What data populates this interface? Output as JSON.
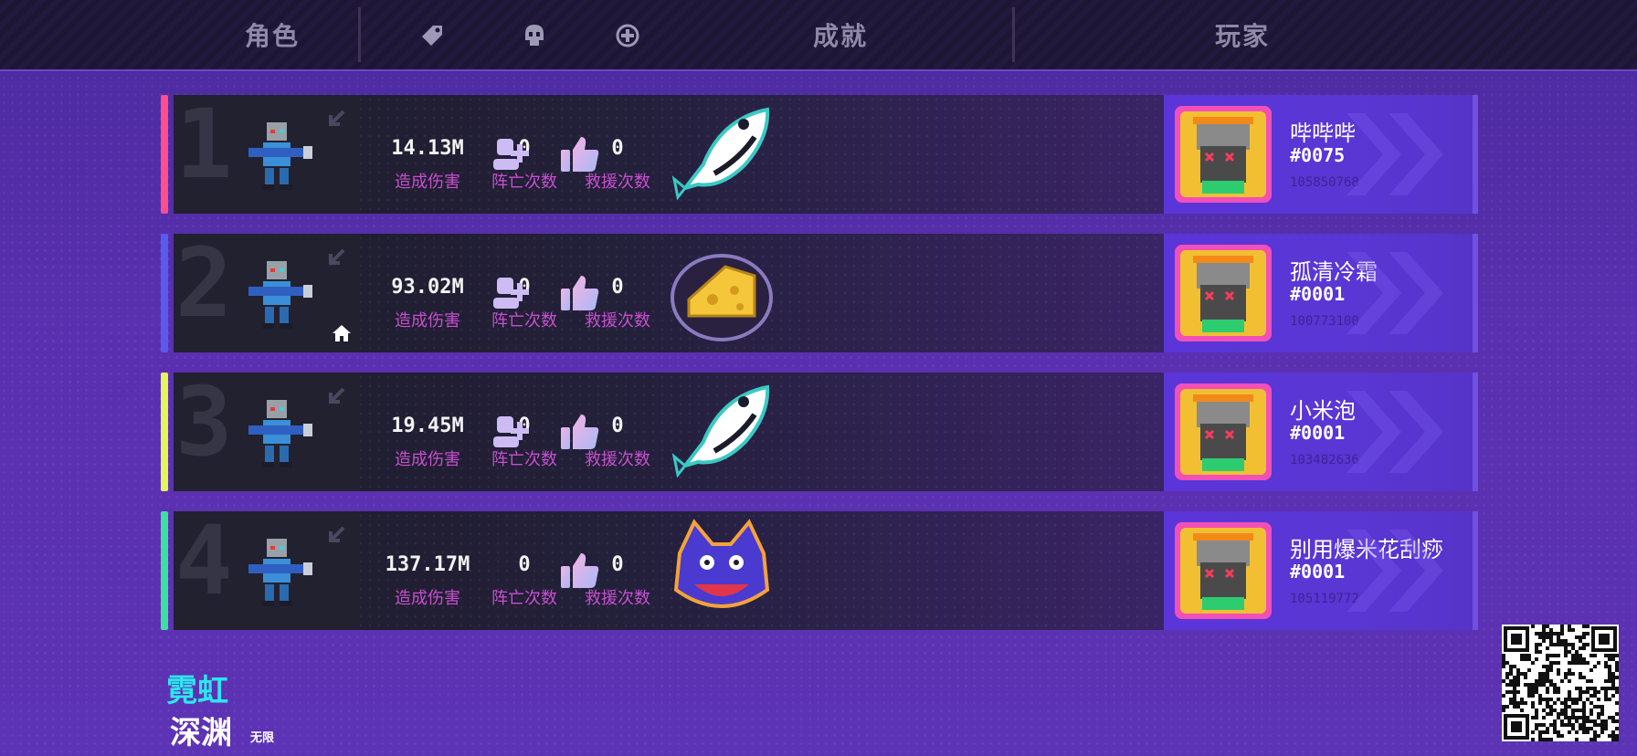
{
  "header": {
    "col_character": "角色",
    "col_achievement": "成就",
    "col_player": "玩家",
    "icons": [
      "tag-icon",
      "skull-icon",
      "plus-circle-icon"
    ]
  },
  "rows": [
    {
      "rank": "1",
      "accent": "#ff4d8d",
      "damage": "14.13M",
      "damage_label": "造成伤害",
      "deaths": "0",
      "deaths_label": "阵亡次数",
      "rescues": "0",
      "rescues_label": "救援次数",
      "achievement_icon": "fish-icon",
      "player_name": "哔哔哔",
      "player_tag": "#0075",
      "player_id": "105850768",
      "has_add_friend": true,
      "is_host": false
    },
    {
      "rank": "2",
      "accent": "#5a5af0",
      "damage": "93.02M",
      "damage_label": "造成伤害",
      "deaths": "0",
      "deaths_label": "阵亡次数",
      "rescues": "0",
      "rescues_label": "救援次数",
      "achievement_icon": "cheese-icon",
      "player_name": "孤清冷霜",
      "player_tag": "#0001",
      "player_id": "100773100",
      "has_add_friend": true,
      "is_host": true
    },
    {
      "rank": "3",
      "accent": "#e4f55a",
      "damage": "19.45M",
      "damage_label": "造成伤害",
      "deaths": "0",
      "deaths_label": "阵亡次数",
      "rescues": "0",
      "rescues_label": "救援次数",
      "achievement_icon": "fish-icon",
      "player_name": "小米泡",
      "player_tag": "#0001",
      "player_id": "103482636",
      "has_add_friend": true,
      "is_host": false
    },
    {
      "rank": "4",
      "accent": "#3ee0a0",
      "damage": "137.17M",
      "damage_label": "造成伤害",
      "deaths": "0",
      "deaths_label": "阵亡次数",
      "rescues": "0",
      "rescues_label": "救援次数",
      "achievement_icon": "wolf-icon",
      "player_name": "别用爆米花刮痧",
      "player_tag": "#0001",
      "player_id": "105119772",
      "has_add_friend": false,
      "is_host": false
    }
  ],
  "logo": {
    "line1": "霓虹",
    "line2": "深渊",
    "badge": "无限"
  }
}
